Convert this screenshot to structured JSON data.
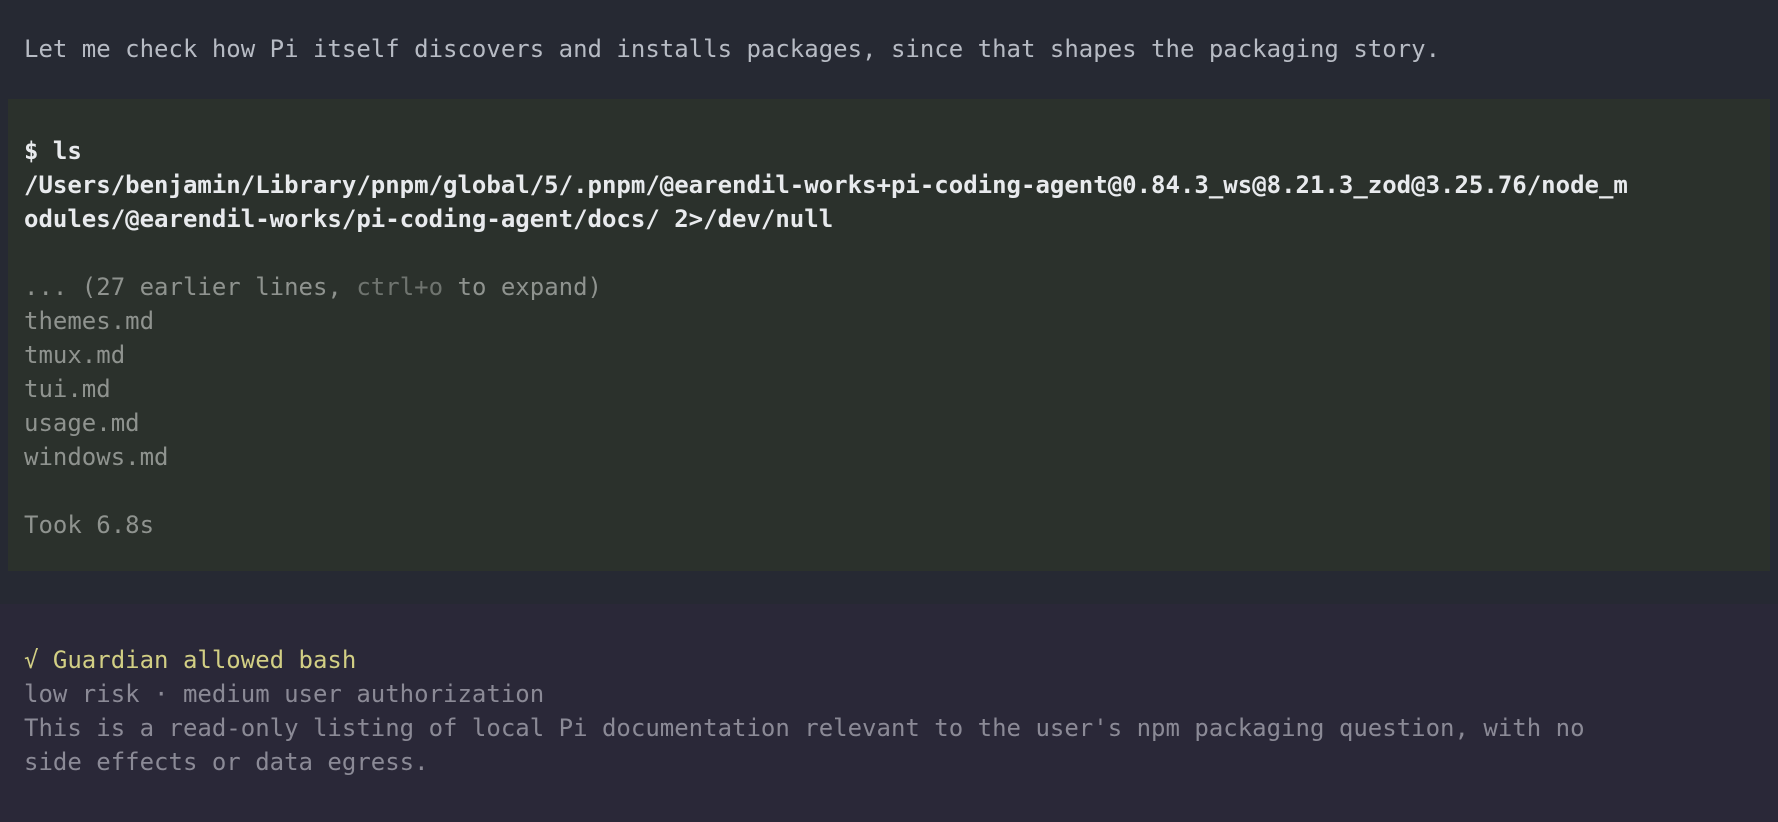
{
  "intro": {
    "text": "Let me check how Pi itself discovers and installs packages, since that shapes the packaging story."
  },
  "bash": {
    "command_lines": [
      "$ ls",
      "/Users/benjamin/Library/pnpm/global/5/.pnpm/@earendil-works+pi-coding-agent@0.84.3_ws@8.21.3_zod@3.25.76/node_m",
      "odules/@earendil-works/pi-coding-agent/docs/ 2>/dev/null"
    ],
    "collapsed": {
      "prefix": "... (27 earlier lines, ",
      "shortcut": "ctrl+o",
      "suffix": " to expand)"
    },
    "output_lines": [
      "themes.md",
      "tmux.md",
      "tui.md",
      "usage.md",
      "windows.md"
    ],
    "duration": "Took 6.8s"
  },
  "guardian": {
    "title": "√ Guardian allowed bash",
    "meta": "low risk · medium user authorization",
    "reason_lines": [
      "This is a read-only listing of local Pi documentation relevant to the user's npm packaging question, with no",
      "side effects or data egress."
    ]
  },
  "colors": {
    "background": "#262933",
    "bash_block": "#2b312c",
    "guardian_block": "#2a2838",
    "guardian_title": "#d2cf84"
  }
}
